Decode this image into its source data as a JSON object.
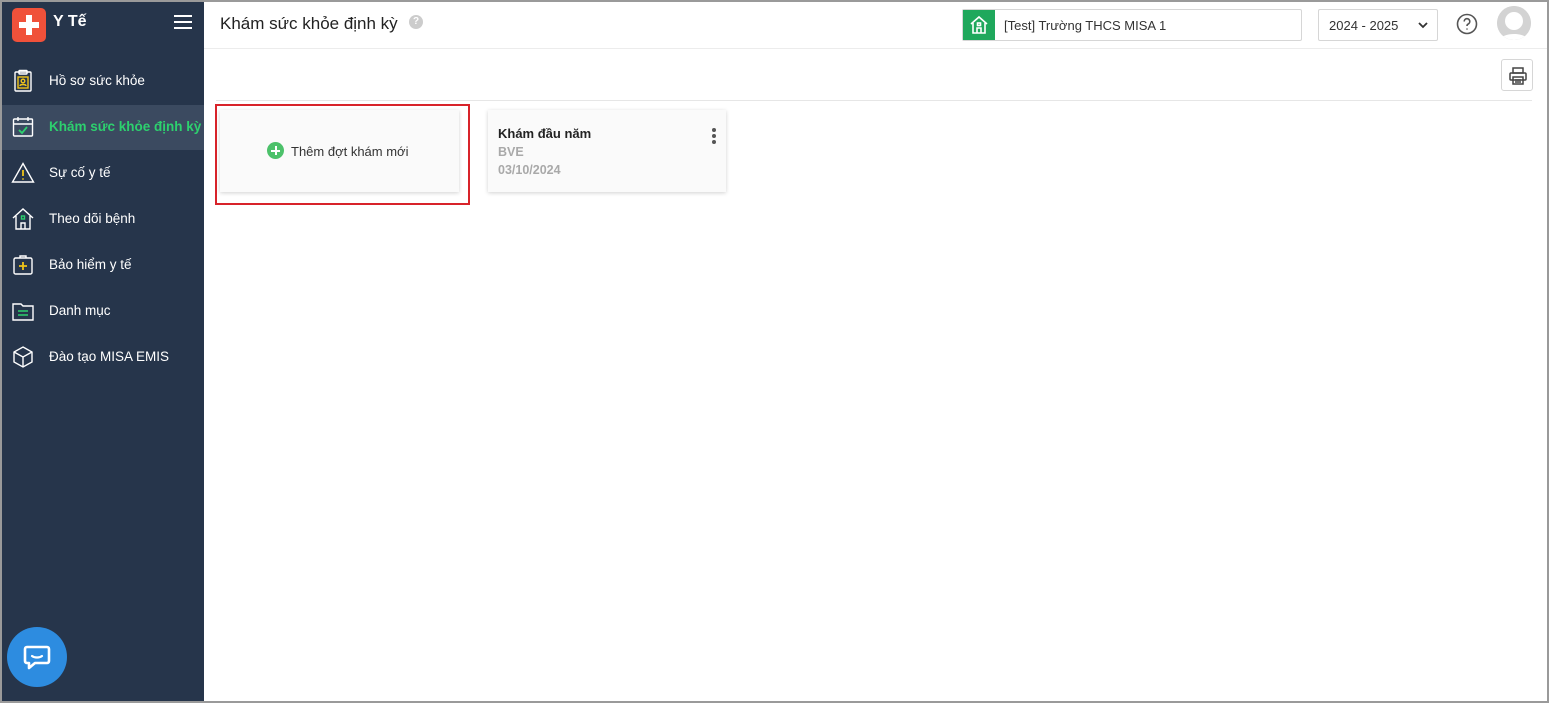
{
  "app": {
    "name": "Y Tế"
  },
  "sidebar": {
    "items": [
      {
        "label": "Hồ sơ sức khỏe",
        "icon": "clipboard-icon",
        "active": false
      },
      {
        "label": "Khám sức khỏe định kỳ",
        "icon": "calendar-check-icon",
        "active": true
      },
      {
        "label": "Sự cố y tế",
        "icon": "warning-icon",
        "active": false
      },
      {
        "label": "Theo dõi bệnh",
        "icon": "house-icon",
        "active": false
      },
      {
        "label": "Bảo hiểm y tế",
        "icon": "medical-kit-icon",
        "active": false
      },
      {
        "label": "Danh mục",
        "icon": "folder-icon",
        "active": false
      },
      {
        "label": "Đào tạo MISA EMIS",
        "icon": "cube-icon",
        "active": false
      }
    ]
  },
  "header": {
    "title": "Khám sức khỏe định kỳ",
    "help_badge": "?",
    "school": "[Test] Trường THCS MISA 1",
    "year": "2024 - 2025"
  },
  "main": {
    "add_card_label": "Thêm đợt khám mới",
    "exam_cards": [
      {
        "title": "Khám đầu năm",
        "unit": "BVE",
        "date": "03/10/2024"
      }
    ]
  },
  "colors": {
    "sidebar_bg": "#26354b",
    "active_text": "#2dd06e",
    "brand": "#f0513a",
    "school_icon_bg": "#1fa85c",
    "highlight": "#d8232a",
    "chat": "#2d8ce0"
  }
}
